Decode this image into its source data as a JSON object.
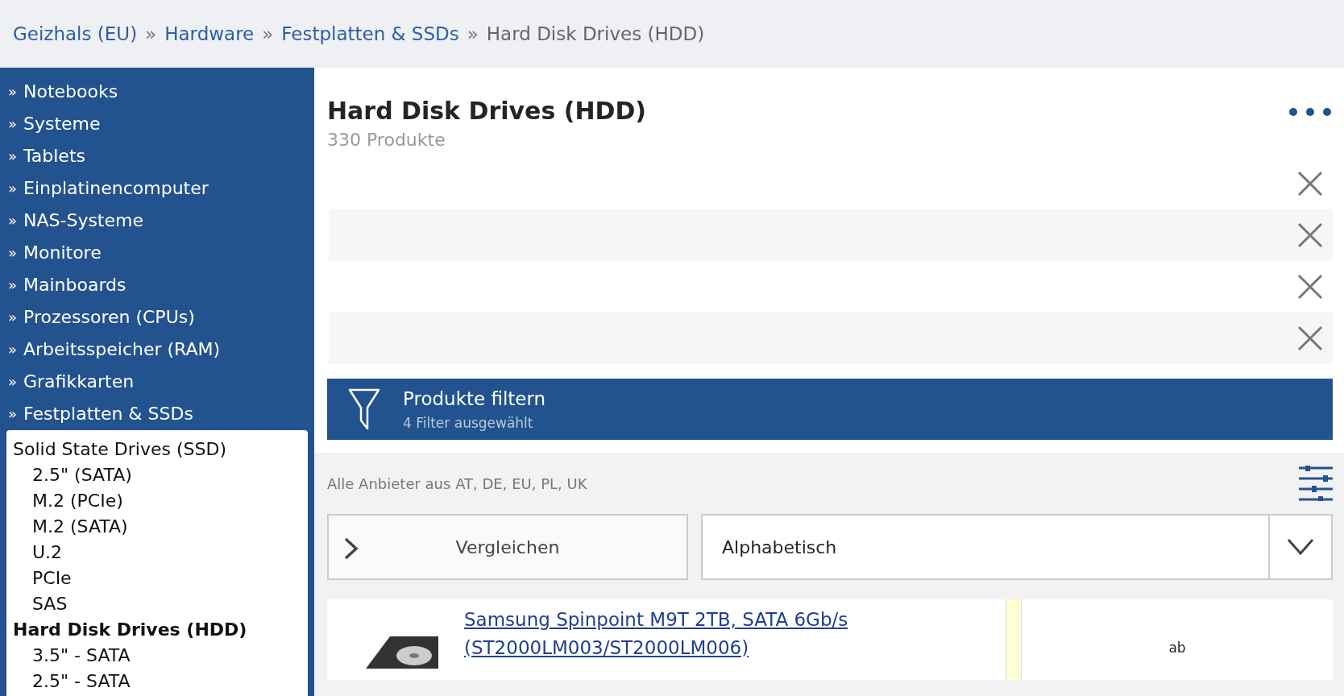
{
  "breadcrumb": [
    {
      "label": "Geizhals (EU)",
      "link": true
    },
    {
      "label": "Hardware",
      "link": true
    },
    {
      "label": "Festplatten & SSDs",
      "link": true
    },
    {
      "label": "Hard Disk Drives (HDD)",
      "link": false
    }
  ],
  "breadcrumb_separator": "»",
  "sidebar": {
    "bullet": "»",
    "items": [
      {
        "label": "Notebooks"
      },
      {
        "label": "Systeme"
      },
      {
        "label": "Tablets"
      },
      {
        "label": "Einplatinencomputer"
      },
      {
        "label": "NAS-Systeme"
      },
      {
        "label": "Monitore"
      },
      {
        "label": "Mainboards"
      },
      {
        "label": "Prozessoren (CPUs)"
      },
      {
        "label": "Arbeitsspeicher (RAM)"
      },
      {
        "label": "Grafikkarten"
      },
      {
        "label": "Festplatten & SSDs"
      }
    ],
    "subcategories": [
      {
        "label": "Solid State Drives (SSD)",
        "selected": false,
        "children": [
          {
            "label": "2.5\" (SATA)",
            "selected": false
          },
          {
            "label": "M.2 (PCIe)",
            "selected": false
          },
          {
            "label": "M.2 (SATA)",
            "selected": false
          },
          {
            "label": "U.2",
            "selected": false
          },
          {
            "label": "PCIe",
            "selected": false
          },
          {
            "label": "SAS",
            "selected": false
          }
        ]
      },
      {
        "label": "Hard Disk Drives (HDD)",
        "selected": true,
        "children": [
          {
            "label": "3.5\" - SATA",
            "selected": false
          },
          {
            "label": "2.5\" - SATA",
            "selected": false
          }
        ]
      }
    ]
  },
  "header": {
    "title": "Hard Disk Drives (HDD)",
    "subtitle": "330 Produkte"
  },
  "active_filters": [
    {
      "removable": true
    },
    {
      "removable": true
    },
    {
      "removable": true
    },
    {
      "removable": true
    }
  ],
  "filter_button": {
    "label": "Produkte filtern",
    "sublabel": "4 Filter ausgewählt"
  },
  "vendors_text": "Alle Anbieter aus AT, DE, EU, PL, UK",
  "compare_button": {
    "label": "Vergleichen"
  },
  "sort_select": {
    "value": "Alphabetisch"
  },
  "products": [
    {
      "name": "Samsung Spinpoint M9T 2TB, SATA 6Gb/s (ST2000LM003/ST2000LM006)",
      "price_prefix": "ab"
    }
  ]
}
